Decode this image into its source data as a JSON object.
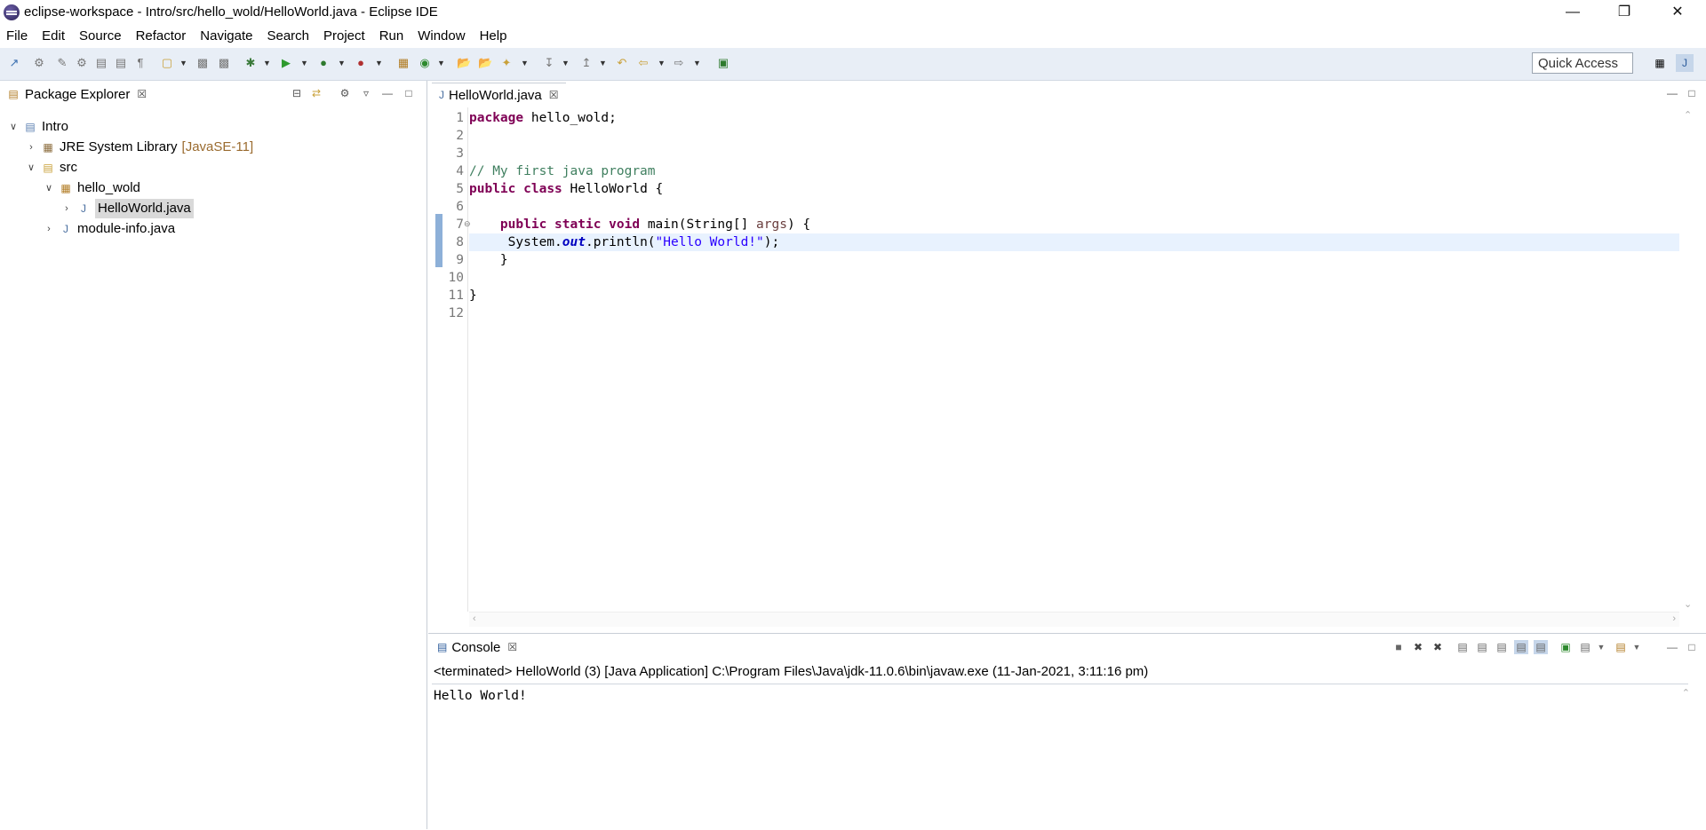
{
  "window": {
    "title": "eclipse-workspace - Intro/src/hello_wold/HelloWorld.java - Eclipse IDE",
    "minimize": "—",
    "restore": "❐",
    "close": "✕"
  },
  "menu": [
    "File",
    "Edit",
    "Source",
    "Refactor",
    "Navigate",
    "Search",
    "Project",
    "Run",
    "Window",
    "Help"
  ],
  "toolbar": {
    "quick_access_placeholder": "Quick Access"
  },
  "package_explorer": {
    "title": "Package Explorer",
    "close": "☒",
    "tree": [
      {
        "label": "Intro",
        "suffix": "",
        "expanded": true,
        "icon": "project-icon"
      },
      {
        "label": "JRE System Library",
        "suffix": "[JavaSE-11]",
        "expanded": false,
        "icon": "library-icon"
      },
      {
        "label": "src",
        "suffix": "",
        "expanded": true,
        "icon": "source-folder-icon"
      },
      {
        "label": "hello_wold",
        "suffix": "",
        "expanded": true,
        "icon": "package-icon"
      },
      {
        "label": "HelloWorld.java",
        "suffix": "",
        "expanded": false,
        "icon": "java-file-icon",
        "selected": true
      },
      {
        "label": "module-info.java",
        "suffix": "",
        "expanded": false,
        "icon": "java-file-icon"
      }
    ]
  },
  "editor": {
    "tab_label": "HelloWorld.java",
    "tab_close": "☒",
    "line_numbers": [
      "1",
      "2",
      "3",
      "4",
      "5",
      "6",
      "7",
      "8",
      "9",
      "10",
      "11",
      "12"
    ],
    "code": {
      "l1_kw": "package",
      "l1_rest": " hello_wold;",
      "l4_comment": "// My first java program",
      "l5_kw1": "public",
      "l5_kw2": "class",
      "l5_rest": " HelloWorld {",
      "l7_kw1": "public",
      "l7_kw2": "static",
      "l7_kw3": "void",
      "l7_rest1": " main(String[] ",
      "l7_param": "args",
      "l7_rest2": ") {",
      "l8_pre": "     System.",
      "l8_field": "out",
      "l8_mid": ".println(",
      "l8_str": "\"Hello World!\"",
      "l8_end": ");",
      "l9": "    }",
      "l11": "}"
    }
  },
  "console": {
    "tab_label": "Console",
    "tab_close": "☒",
    "status": "<terminated> HelloWorld (3) [Java Application] C:\\Program Files\\Java\\jdk-11.0.6\\bin\\javaw.exe (11-Jan-2021, 3:11:16 pm)",
    "output": "Hello World!"
  }
}
